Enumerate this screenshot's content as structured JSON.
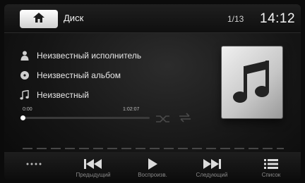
{
  "header": {
    "title": "Диск",
    "track_counter": "1/13",
    "clock": "14:12"
  },
  "track": {
    "artist": "Неизвестный исполнитель",
    "album": "Неизвестный альбом",
    "song": "Неизвестный"
  },
  "progress": {
    "elapsed": "0:00",
    "total": "1:02:07",
    "fraction": 0.0
  },
  "controls": {
    "more_label": "",
    "prev_label": "Предыдущий",
    "play_label": "Воспроизв.",
    "next_label": "Следующий",
    "list_label": "Список"
  },
  "icons": {
    "home": "home-icon",
    "artist": "person-icon",
    "album": "disc-icon",
    "song": "music-note-icon",
    "shuffle": "shuffle-icon",
    "repeat": "repeat-icon",
    "album_art": "music-note-icon",
    "more": "dots-icon",
    "prev": "skip-previous-icon",
    "play": "play-icon",
    "next": "skip-next-icon",
    "list": "list-icon"
  }
}
